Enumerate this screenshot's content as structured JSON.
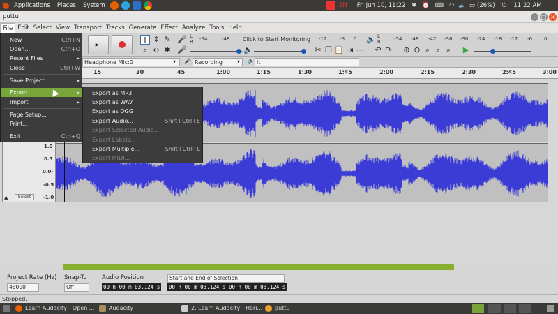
{
  "system_bar": {
    "applications": "Applications",
    "places": "Places",
    "system": "System",
    "lang": "EN",
    "datetime": "Fri Jun 10, 11:22",
    "battery": "(26%)",
    "clock": "11:22 AM"
  },
  "window": {
    "title": "puttu"
  },
  "menubar": [
    "File",
    "Edit",
    "Select",
    "View",
    "Transport",
    "Tracks",
    "Generate",
    "Effect",
    "Analyze",
    "Tools",
    "Help"
  ],
  "toolbar": {
    "monitor_hint": "Click to Start Monitoring",
    "rec_meter_ticks": [
      "-54",
      "-48",
      "-12",
      "-6",
      "0"
    ],
    "play_meter_ticks": [
      "-54",
      "-48",
      "-42",
      "-36",
      "-30",
      "-24",
      "-18",
      "-12",
      "-6",
      "0"
    ],
    "play_meter_ticks2": [
      "-24",
      "-12",
      "0"
    ],
    "meter_lr": [
      "L",
      "R"
    ]
  },
  "device_bar": {
    "input_device": "Headphone Mic:0",
    "channels": "Recording Channel",
    "output_device": "lt"
  },
  "ruler": {
    "ticks": [
      "15",
      "30",
      "45",
      "1:00",
      "1:15",
      "1:30",
      "1:45",
      "2:00",
      "2:15",
      "2:30",
      "2:45",
      "3:00"
    ]
  },
  "track": {
    "scale_labels": [
      "1.0",
      "0.5",
      "0.0-",
      "-0.5",
      "-1.0"
    ],
    "select_button": "Select",
    "waveform_color": "#3b3bd6"
  },
  "file_menu": {
    "items": [
      {
        "label": "New",
        "shortcut": "Ctrl+N"
      },
      {
        "label": "Open...",
        "shortcut": "Ctrl+O"
      },
      {
        "label": "Recent Files",
        "shortcut": ""
      },
      {
        "label": "Close",
        "shortcut": "Ctrl+W"
      },
      {
        "label": "Save Project",
        "shortcut": ""
      },
      {
        "label": "Export",
        "shortcut": ""
      },
      {
        "label": "Import",
        "shortcut": ""
      },
      {
        "label": "Page Setup...",
        "shortcut": ""
      },
      {
        "label": "Print...",
        "shortcut": ""
      },
      {
        "label": "Exit",
        "shortcut": "Ctrl+Q"
      }
    ]
  },
  "export_submenu": {
    "items": [
      {
        "label": "Export as MP3",
        "shortcut": "",
        "enabled": true
      },
      {
        "label": "Export as WAV",
        "shortcut": "",
        "enabled": true
      },
      {
        "label": "Export as OGG",
        "shortcut": "",
        "enabled": true
      },
      {
        "label": "Export Audio...",
        "shortcut": "Shift+Ctrl+E",
        "enabled": true
      },
      {
        "label": "Export Selected Audio...",
        "shortcut": "",
        "enabled": false
      },
      {
        "label": "Export Labels...",
        "shortcut": "",
        "enabled": false
      },
      {
        "label": "Export Multiple...",
        "shortcut": "Shift+Ctrl+L",
        "enabled": true
      },
      {
        "label": "Export MIDI...",
        "shortcut": "",
        "enabled": false
      }
    ]
  },
  "selection_bar": {
    "project_rate_label": "Project Rate (Hz)",
    "project_rate": "48000",
    "snap_label": "Snap-To",
    "snap_value": "Off",
    "audio_position_label": "Audio Position",
    "audio_position": "00 h 00 m 03.124 s",
    "selection_mode": "Start and End of Selection",
    "sel_start": "00 h 00 m 03.124 s",
    "sel_end": "00 h 00 m 03.124 s"
  },
  "status": "Stopped.",
  "taskbar": {
    "tasks": [
      "Learn Audacity - Open ...",
      "Audacity",
      "2. Learn Audacity - Hari...",
      "puttu"
    ]
  },
  "colors": {
    "accent": "#78a63b",
    "waveform": "#3b3bd6",
    "record": "#e03030"
  }
}
